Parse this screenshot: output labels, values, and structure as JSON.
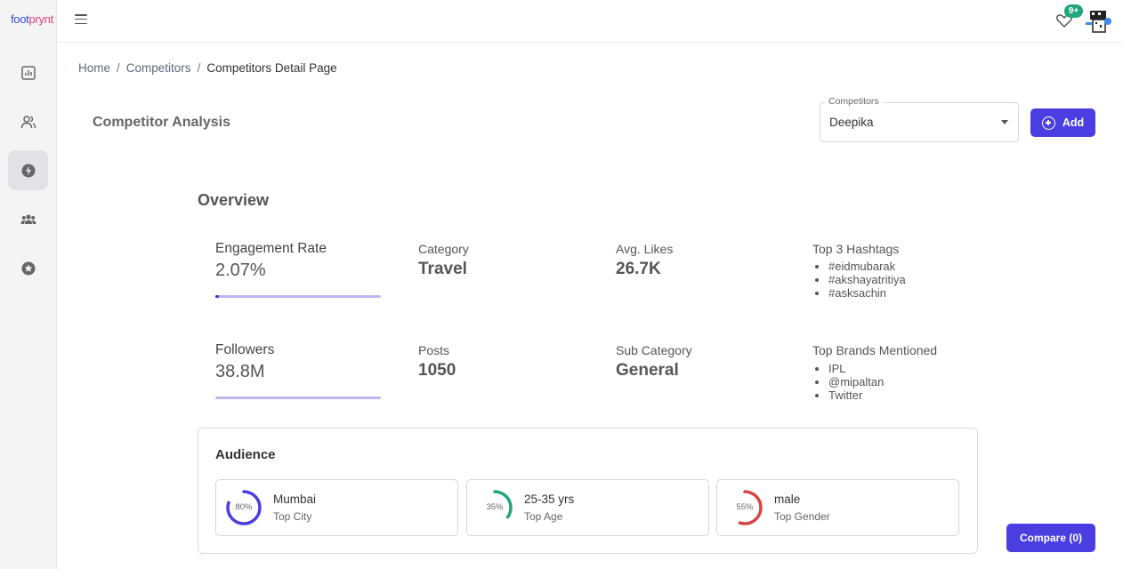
{
  "app": {
    "logo_part1": "foot",
    "logo_part2": "prynt"
  },
  "topbar": {
    "notification_badge": "9+"
  },
  "sidebar": {
    "items": [
      {
        "icon": "bar-chart-icon"
      },
      {
        "icon": "users-icon"
      },
      {
        "icon": "lightning-icon",
        "active": true
      },
      {
        "icon": "group-icon"
      },
      {
        "icon": "star-icon"
      }
    ]
  },
  "breadcrumb": {
    "home": "Home",
    "sep1": "/",
    "competitors": "Competitors",
    "sep2": "/",
    "current": "Competitors Detail Page"
  },
  "page": {
    "title": "Competitor Analysis"
  },
  "competitor_select": {
    "legend": "Competitors",
    "value": "Deepika"
  },
  "buttons": {
    "add": "Add",
    "compare": "Compare (0)"
  },
  "overview": {
    "title": "Overview",
    "engagement": {
      "label": "Engagement Rate",
      "value": "2.07%",
      "bar_fraction": 0.0207
    },
    "category": {
      "label": "Category",
      "value": "Travel"
    },
    "avg_likes": {
      "label": "Avg. Likes",
      "value": "26.7K"
    },
    "hashtags": {
      "label": "Top 3 Hashtags",
      "items": [
        "#eidmubarak",
        "#akshayatritiya",
        "#asksachin"
      ]
    },
    "followers": {
      "label": "Followers",
      "value": "38.8M",
      "bar_fraction": 0
    },
    "posts": {
      "label": "Posts",
      "value": "1050"
    },
    "sub_category": {
      "label": "Sub Category",
      "value": "General"
    },
    "brands": {
      "label": "Top Brands Mentioned",
      "items": [
        "IPL",
        "@mipaltan",
        "Twitter"
      ]
    }
  },
  "audience": {
    "title": "Audience",
    "cards": [
      {
        "pct_label": "80%",
        "percent": 80,
        "color": "#4a3ee0",
        "value": "Mumbai",
        "label": "Top City"
      },
      {
        "pct_label": "35%",
        "percent": 35,
        "color": "#1fa67a",
        "value": "25-35 yrs",
        "label": "Top Age"
      },
      {
        "pct_label": "55%",
        "percent": 55,
        "color": "#d64545",
        "value": "male",
        "label": "Top Gender"
      }
    ]
  }
}
